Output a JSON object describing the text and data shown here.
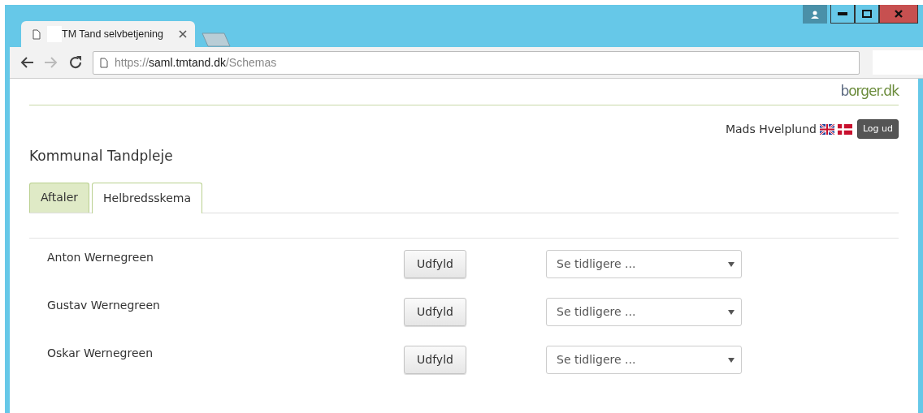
{
  "browser": {
    "tabs": [
      {
        "title": "TM Tand selvbetjening",
        "selected": true
      }
    ],
    "address": {
      "scheme": "https://",
      "host": "saml.tmtand.dk",
      "path": "/Schemas"
    }
  },
  "site": {
    "logo": "borger.dk",
    "user": "Mads Hvelplund",
    "logout": "Log ud",
    "heading": "Kommunal Tandpleje"
  },
  "tabs": [
    {
      "label": "Aftaler",
      "selected": false
    },
    {
      "label": "Helbredsskema",
      "selected": true
    }
  ],
  "people": [
    {
      "name": "Anton Wernegreen",
      "button": "Udfyld",
      "select_placeholder": "Se tidligere ..."
    },
    {
      "name": "Gustav Wernegreen",
      "button": "Udfyld",
      "select_placeholder": "Se tidligere ..."
    },
    {
      "name": "Oskar Wernegreen",
      "button": "Udfyld",
      "select_placeholder": "Se tidligere ..."
    }
  ]
}
